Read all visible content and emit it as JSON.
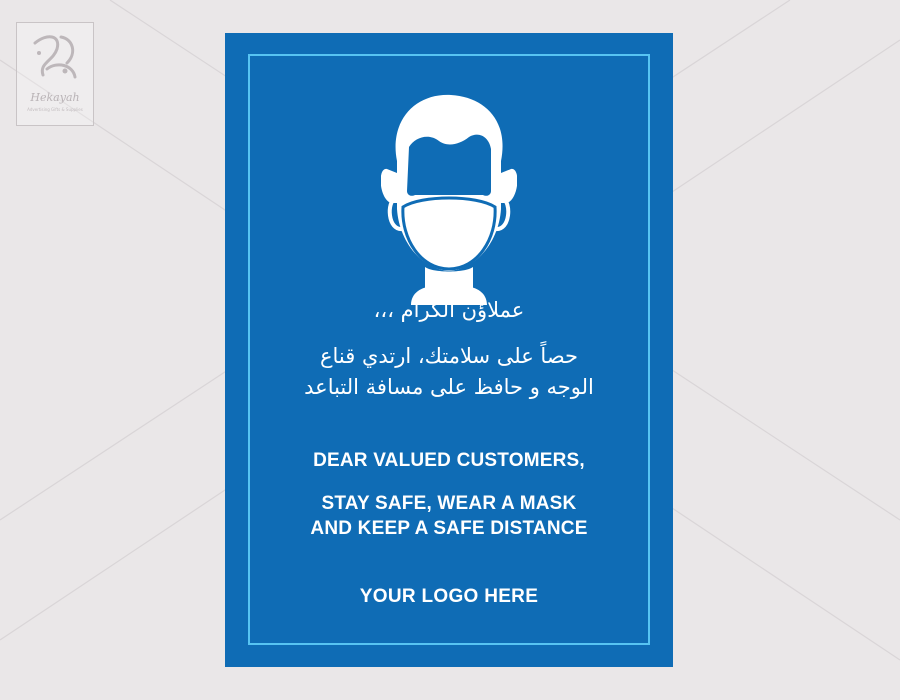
{
  "watermark": {
    "brand_name": "Hekayah",
    "tagline": "Advertising Gifts & Supplies"
  },
  "poster": {
    "icon": "face-mask-icon",
    "greeting_ar": "عملاؤن الكرام ،،،",
    "message_ar_line1": "حصاً على سلامتك، ارتدي قناع",
    "message_ar_line2": "الوجه و حافظ على مسافة التباعد",
    "greeting_en": "DEAR VALUED CUSTOMERS,",
    "message_en_line1": "STAY SAFE, WEAR A MASK",
    "message_en_line2": "AND KEEP A SAFE DISTANCE",
    "logo_placeholder": "YOUR LOGO HERE"
  },
  "colors": {
    "background": "#eae7e8",
    "poster_blue": "#0f6cb5",
    "frame_light_blue": "#57c4f2",
    "text": "#ffffff"
  }
}
